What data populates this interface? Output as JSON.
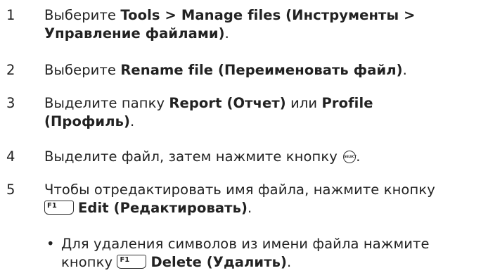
{
  "steps": [
    {
      "num": "1",
      "line1_pre": "Выберите ",
      "line1_bold": "Tools > Manage files (Инструменты >",
      "line2_bold": "Управление файлами)",
      "line2_post": "."
    },
    {
      "num": "2",
      "pre": "Выберите ",
      "bold": "Rename file (Переименовать файл)",
      "post": "."
    },
    {
      "num": "3",
      "pre": "Выделите папку ",
      "bold_a": "Report (Отчет)",
      "mid": " или ",
      "bold_b": "Profile",
      "line2_bold": "(Профиль)",
      "line2_post": "."
    },
    {
      "num": "4",
      "pre": "Выделите файл, затем нажмите кнопку ",
      "key_label": "SELECT",
      "post": "."
    },
    {
      "num": "5",
      "line1": "Чтобы отредактировать имя файла, нажмите кнопку",
      "key_label": "F1",
      "bold": "Edit (Редактировать)",
      "post": "."
    }
  ],
  "bullet": {
    "symbol": "•",
    "line1": "Для удаления символов из имени файла нажмите",
    "line2_pre": "кнопку ",
    "key_label": "F1",
    "bold": "Delete (Удалить)",
    "post": "."
  }
}
